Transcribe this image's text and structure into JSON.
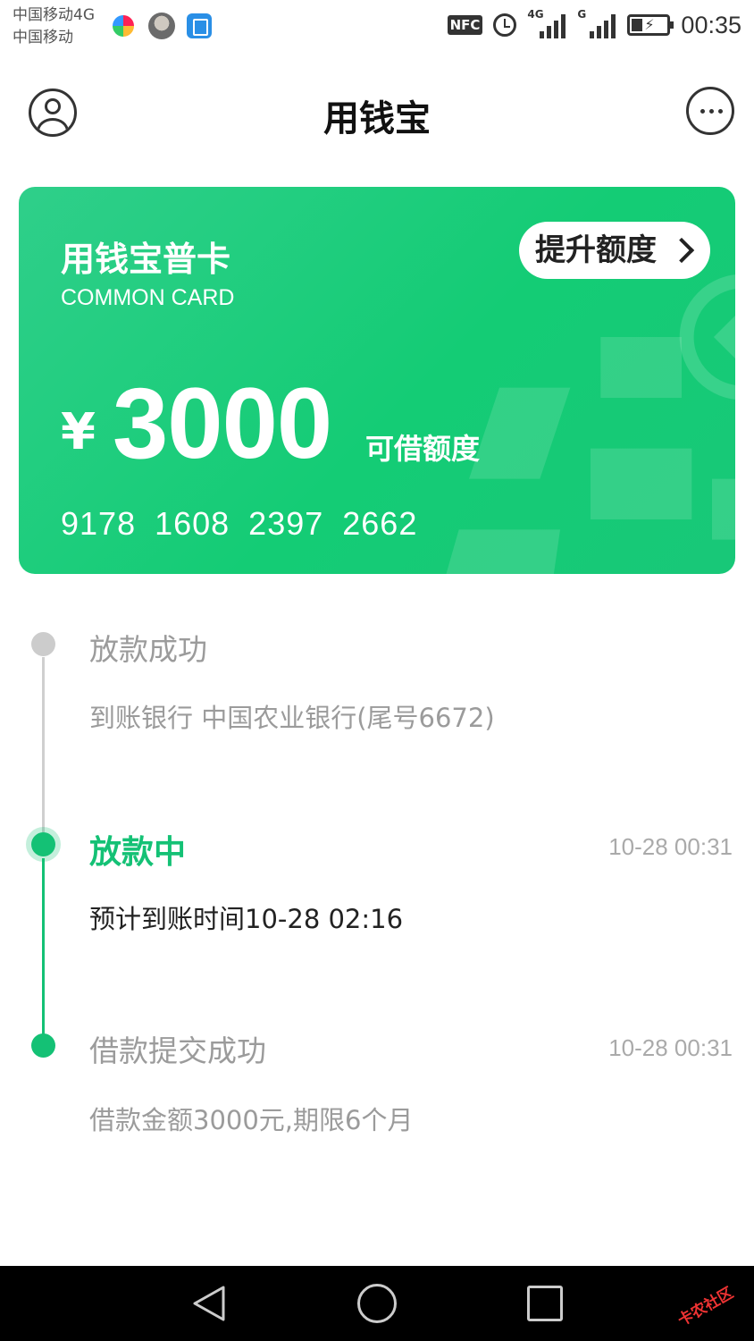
{
  "status_bar": {
    "carrier_line1": "中国移动4G",
    "carrier_line2": "中国移动",
    "nfc_label": "NFC",
    "network1": "4G",
    "network2": "G",
    "time": "00:35"
  },
  "header": {
    "title": "用钱宝",
    "left_icon": "user-profile-icon",
    "right_icon": "more-options-icon"
  },
  "card": {
    "name": "用钱宝普卡",
    "subtitle": "COMMON CARD",
    "raise_button": "提升额度",
    "currency": "¥",
    "amount": "3000",
    "amount_label": "可借额度",
    "card_number": "9178 1608 2397 2662",
    "color": "#1dcc7c"
  },
  "timeline": [
    {
      "title": "放款成功",
      "desc": "到账银行 中国农业银行(尾号6672)",
      "time": "",
      "state": "pending"
    },
    {
      "title": "放款中",
      "desc": "预计到账时间10-28 02:16",
      "time": "10-28 00:31",
      "state": "current"
    },
    {
      "title": "借款提交成功",
      "desc": "借款金额3000元,期限6个月",
      "time": "10-28 00:31",
      "state": "done"
    }
  ],
  "colors": {
    "accent": "#14c175",
    "muted": "#9b9b9b",
    "pending_dot": "#cccccc"
  },
  "nav_bar": {
    "back_icon": "back-triangle-icon",
    "home_icon": "home-circle-icon",
    "recent_icon": "recent-square-icon",
    "watermark": "卡农社区"
  }
}
